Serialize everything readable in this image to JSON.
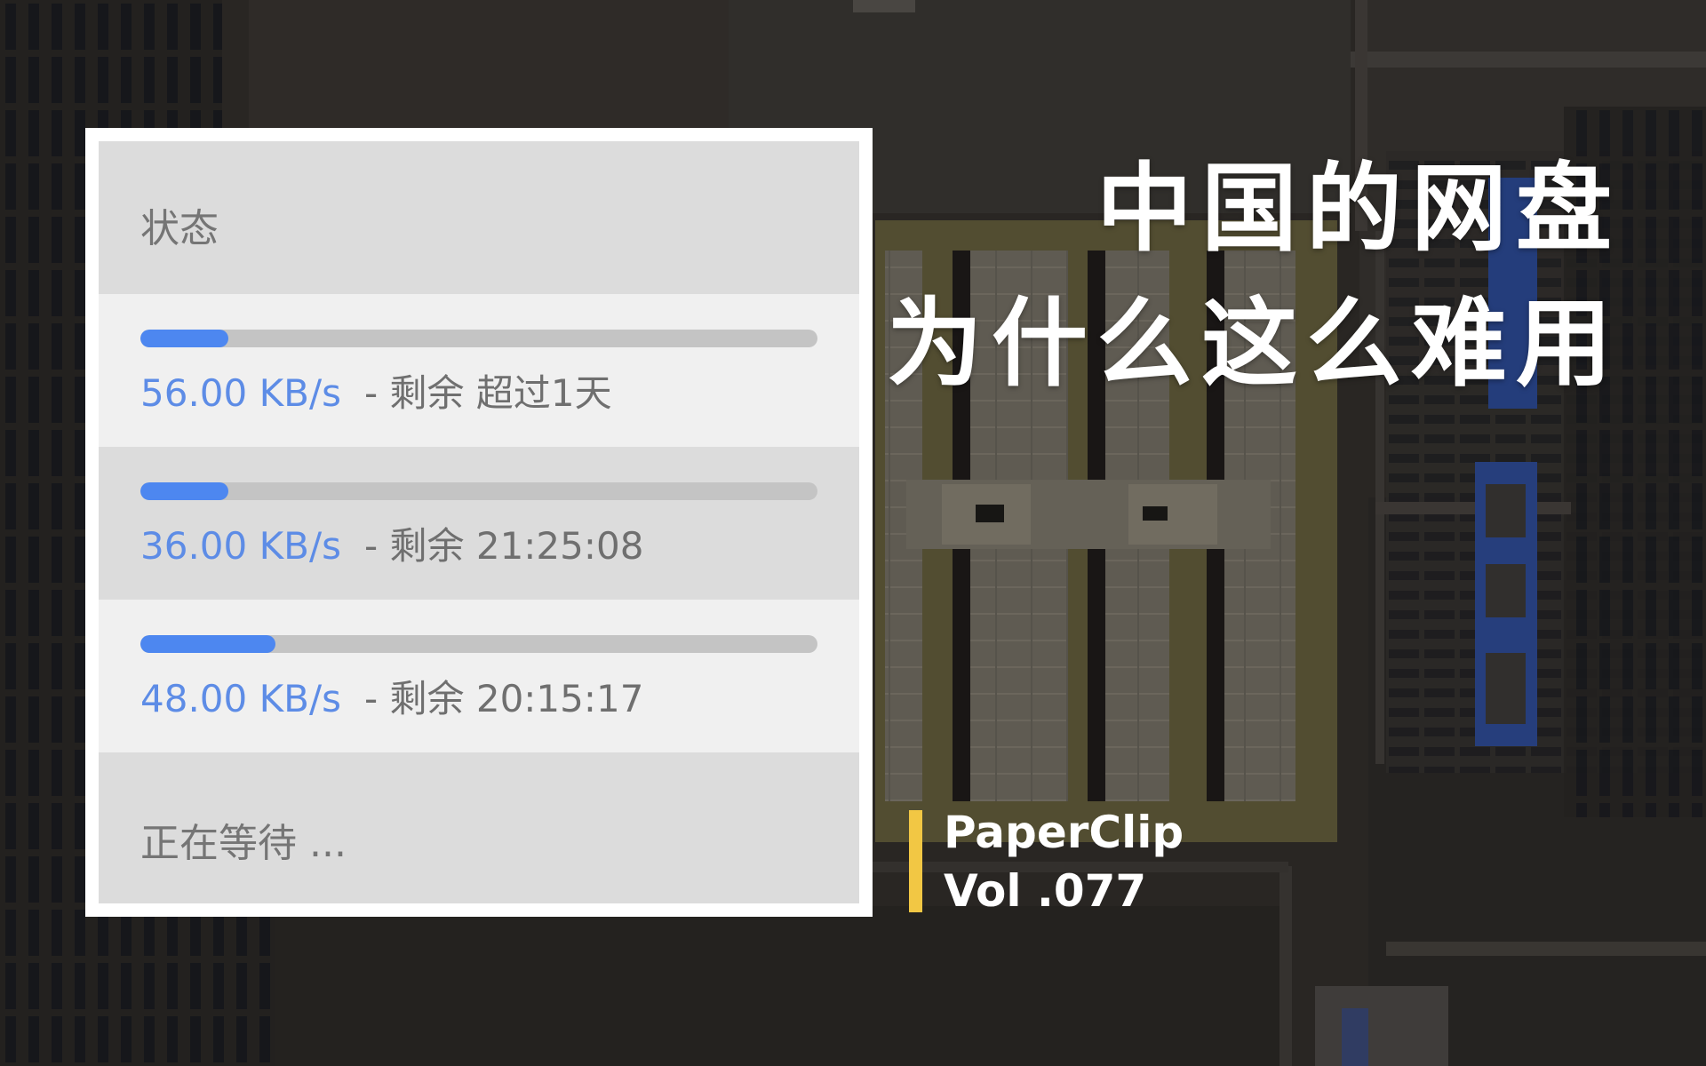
{
  "background": {
    "type": "aerial-satellite-image",
    "colors": {
      "base": "#2f2c29",
      "highlight_site": "#6f6540",
      "solar_panels": "#2a4a9a"
    }
  },
  "panel": {
    "header": "状态",
    "downloads": [
      {
        "progress": 0.13,
        "speed": "56.00  KB/s",
        "remaining": "- 剩余 超过1天"
      },
      {
        "progress": 0.13,
        "speed": "36.00  KB/s",
        "remaining": "- 剩余 21:25:08"
      },
      {
        "progress": 0.2,
        "speed": "48.00  KB/s",
        "remaining": "- 剩余 20:15:17"
      }
    ],
    "footer": "正在等待 ...",
    "colors": {
      "progress_fill": "#4d87f0",
      "progress_track": "#c4c4c4",
      "speed_text": "#5d8ce6"
    }
  },
  "title": {
    "line1": "中国的网盘",
    "line2": "为什么这么难用"
  },
  "brand": {
    "name": "PaperClip",
    "volume": "Vol .077",
    "accent": "#f2c744"
  }
}
